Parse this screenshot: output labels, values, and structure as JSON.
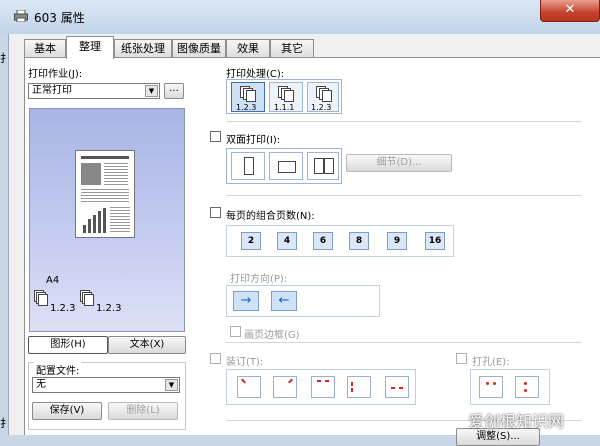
{
  "window": {
    "title": "603 属性",
    "left_fragment_top": "扌",
    "left_fragment_bottom": "扌",
    "close_label": "✕"
  },
  "tabs": [
    {
      "label": "基本"
    },
    {
      "label": "整理"
    },
    {
      "label": "纸张处理"
    },
    {
      "label": "图像质量"
    },
    {
      "label": "效果"
    },
    {
      "label": "其它"
    }
  ],
  "left": {
    "print_job_label": "打印作业(J):",
    "print_job_value": "正常打印",
    "print_job_more": "...",
    "paper_size": "A4",
    "preview_caption_1": "1.2.3",
    "preview_caption_2": "1.2.3",
    "view_tabs": [
      {
        "label": "图形(H)"
      },
      {
        "label": "文本(X)"
      }
    ],
    "profile_label": "配置文件:",
    "profile_value": "无",
    "save_label": "保存(V)",
    "delete_label": "删除(L)"
  },
  "right": {
    "print_process_label": "打印处理(C):",
    "print_process_options": [
      {
        "caption": "1.2.3",
        "selected": true
      },
      {
        "caption": "1.1.1",
        "selected": false
      },
      {
        "caption": "1.2.3",
        "selected": false
      }
    ],
    "duplex_label": "双面打印(I):",
    "details_label": "细节(D)...",
    "pages_per_sheet_label": "每页的组合页数(N):",
    "pages_per_sheet_options": [
      "2",
      "4",
      "6",
      "8",
      "9",
      "16"
    ],
    "orientation_label": "打印方向(P):",
    "orientation_options": [
      "→",
      "←"
    ],
    "page_border_label": "画页边框(G)",
    "staple_label": "装订(T):",
    "punch_label": "打孔(E):",
    "bottom_fragment": "调整(S)..."
  },
  "watermark": "爱创根知识网",
  "colors": {
    "accent": "#3b6fb6",
    "close_red": "#c5422d",
    "preview_blue": "#a8b4e4"
  }
}
